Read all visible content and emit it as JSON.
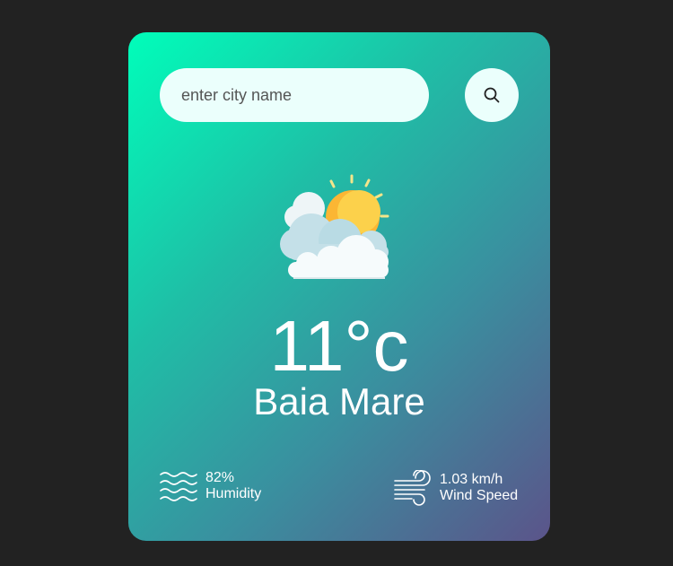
{
  "search": {
    "placeholder": "enter city name",
    "button_icon": "search-icon"
  },
  "weather": {
    "icon": "partly-cloudy-sun-icon",
    "temperature": "11°c",
    "city": "Baia Mare"
  },
  "details": {
    "humidity": {
      "icon": "humidity-waves-icon",
      "value": "82%",
      "label": "Humidity"
    },
    "wind": {
      "icon": "wind-icon",
      "value": "1.03 km/h",
      "label": "Wind Speed"
    }
  },
  "colors": {
    "page_background": "#222222",
    "gradient_start": "#00feba",
    "gradient_end": "#5b548a",
    "input_background": "#ebfffc",
    "text": "#ffffff"
  }
}
